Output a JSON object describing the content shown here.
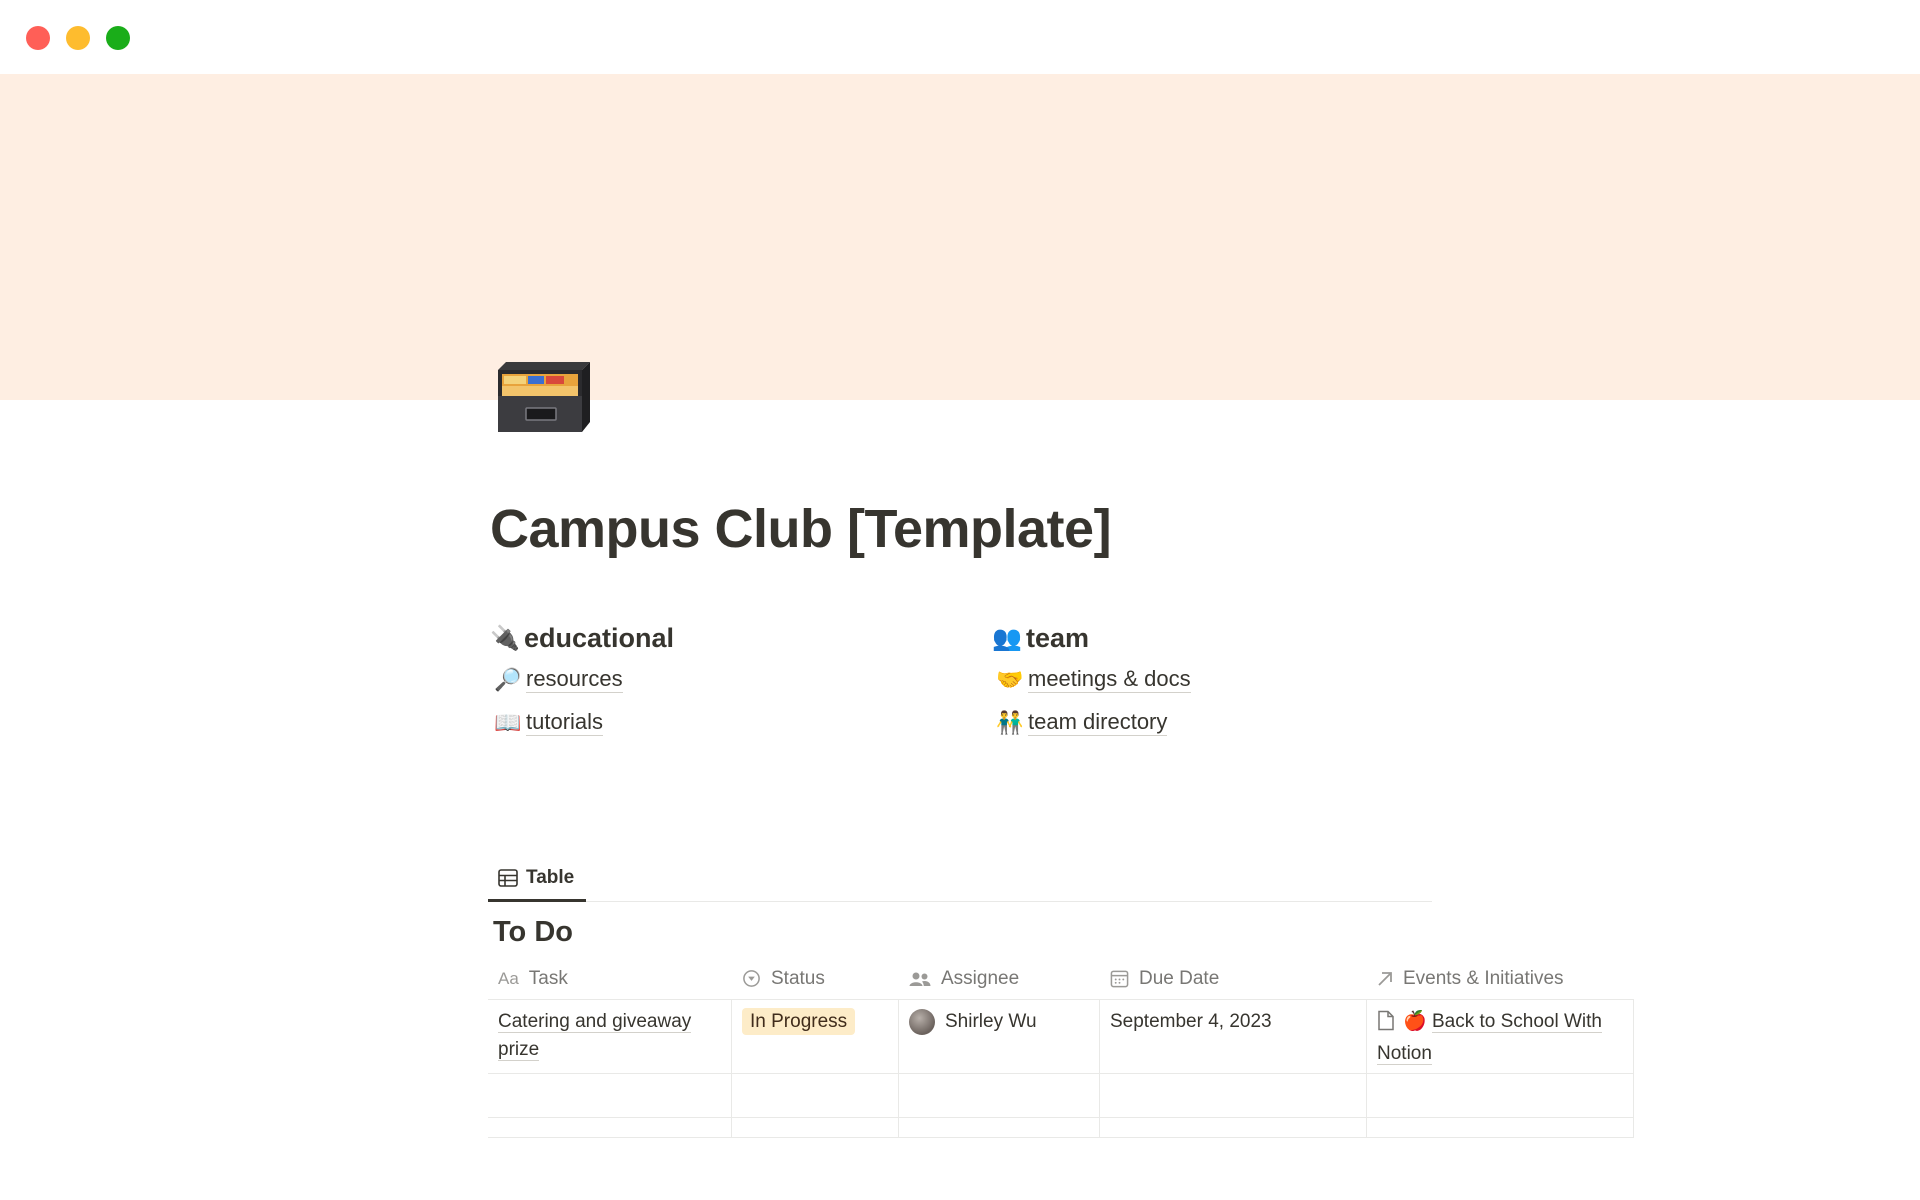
{
  "window": {
    "controls": [
      "close",
      "minimize",
      "maximize"
    ]
  },
  "page": {
    "icon": "card-file-box-icon",
    "title": "Campus Club [Template]"
  },
  "columns": [
    {
      "heading": {
        "emoji": "🔌",
        "label": "educational"
      },
      "links": [
        {
          "emoji": "🔎",
          "label": "resources"
        },
        {
          "emoji": "📖",
          "label": "tutorials"
        }
      ]
    },
    {
      "heading": {
        "emoji": "👥",
        "label": "team"
      },
      "links": [
        {
          "emoji": "🤝",
          "label": "meetings & docs"
        },
        {
          "emoji": "👬",
          "label": "team directory"
        }
      ]
    }
  ],
  "views": {
    "active_tab": "Table"
  },
  "database": {
    "title": "To Do",
    "columns": [
      {
        "icon": "Aa",
        "label": "Task"
      },
      {
        "icon": "status-icon",
        "label": "Status"
      },
      {
        "icon": "people-icon",
        "label": "Assignee"
      },
      {
        "icon": "calendar-icon",
        "label": "Due Date"
      },
      {
        "icon": "relation-arrow-icon",
        "label": "Events & Initiatives"
      }
    ],
    "rows": [
      {
        "task": "Catering and giveaway prize",
        "status": "In Progress",
        "status_color": "#fdecc8",
        "assignee": "Shirley Wu",
        "due_date": "September 4, 2023",
        "relation": {
          "emoji": "🍎",
          "label": "Back to School With Notion"
        }
      }
    ]
  },
  "colors": {
    "cover": "#feeee2",
    "text": "#37352f",
    "muted": "#787774"
  }
}
